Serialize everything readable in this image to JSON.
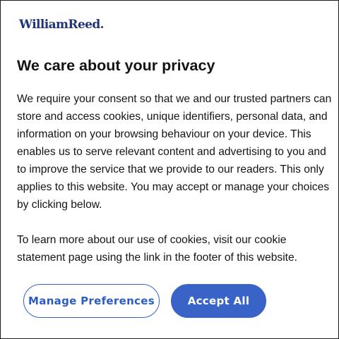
{
  "brand": {
    "logo_text": "WilliamReed.",
    "color": "#1f3578"
  },
  "consent": {
    "title": "We care about your privacy",
    "paragraph1": "We require your consent so that we and our trusted partners can store and access cookies, unique identifiers, personal data, and information on your browsing behaviour on your device. This enables us to serve relevant content and advertising to you and to improve the service that we provide to our readers. This only applies to this website. You may accept or manage your choices by clicking below.",
    "paragraph2": "To learn more about our use of cookies, visit our cookie statement page using the link in the footer of this website."
  },
  "buttons": {
    "manage_label": "Manage Preferences",
    "accept_label": "Accept All"
  },
  "colors": {
    "accent": "#3a63c8",
    "text": "#141414",
    "background": "#ffffff"
  }
}
